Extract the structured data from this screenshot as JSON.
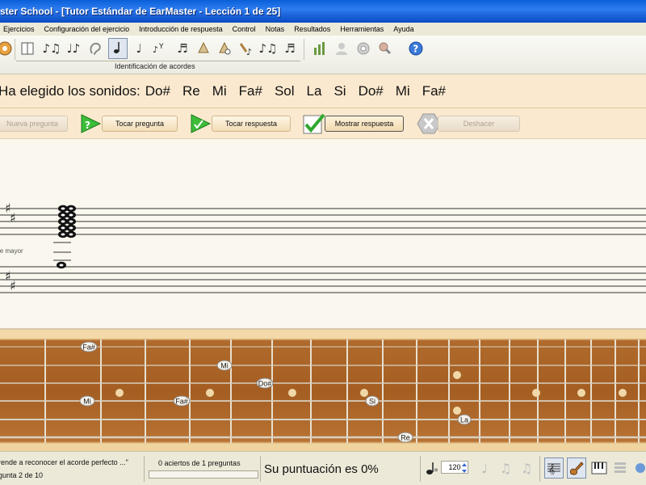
{
  "window": {
    "title": "ster School - [Tutor Estándar de EarMaster - Lección 1 de 25]"
  },
  "menu": [
    "Ejercicios",
    "Configuración del ejercicio",
    "Introducción de respuesta",
    "Control",
    "Notas",
    "Resultados",
    "Herramientas",
    "Ayuda"
  ],
  "toolbar": {
    "caption": "Identificación de acordes",
    "help_glyph": "?"
  },
  "chosen_sounds": {
    "label": "Ha elegido los sonidos:",
    "notes": [
      "Do#",
      "Re",
      "Mi",
      "Fa#",
      "Sol",
      "La",
      "Si",
      "Do#",
      "Mi",
      "Fa#"
    ]
  },
  "actions": {
    "new_question": "Nueva pregunta",
    "play_question": "Tocar pregunta",
    "play_answer": "Tocar respuesta",
    "show_answer": "Mostrar respuesta",
    "delete": "Deshacer"
  },
  "staff": {
    "key_label": "le mayor"
  },
  "fretboard": {
    "note_labels": [
      {
        "name": "Fa#"
      },
      {
        "name": "Mi"
      },
      {
        "name": "Do#"
      },
      {
        "name": "Mi"
      },
      {
        "name": "Fa#"
      },
      {
        "name": "Si"
      },
      {
        "name": "La"
      },
      {
        "name": "Re"
      }
    ]
  },
  "status": {
    "lesson_text": "rende a reconocer el acorde perfecto ...\"",
    "question_text": "gunta 2 de 10",
    "answers_text": "0 aciertos de 1 preguntas",
    "score_text": "Su puntuación es 0%",
    "tempo_value": "120"
  },
  "colors": {
    "title_bar": "#1b62d8",
    "panel_bg": "#fbe9cf",
    "fretboard_wood": "#a55e22",
    "green_arrow": "#3dbd3a"
  }
}
